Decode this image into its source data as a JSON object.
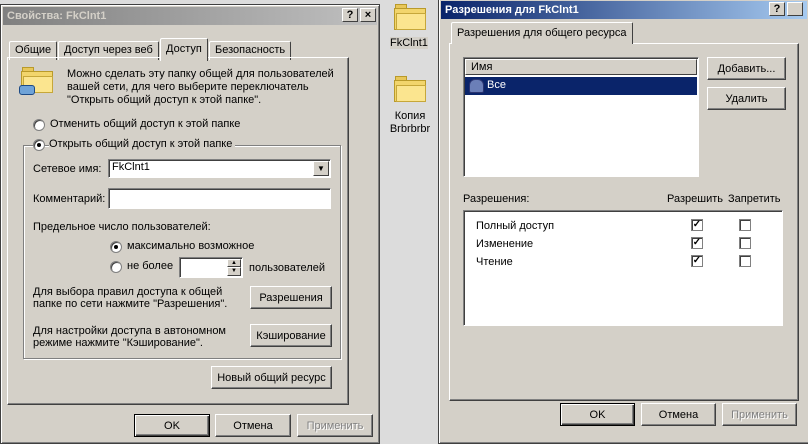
{
  "properties_dialog": {
    "title": "Свойства: FkClnt1",
    "help_glyph": "?",
    "close_glyph": "×",
    "tabs": [
      "Общие",
      "Доступ через веб",
      "Доступ",
      "Безопасность"
    ],
    "description": "Можно сделать эту папку общей для пользователей вашей сети, для чего выберите переключатель \"Открыть общий доступ к этой папке\".",
    "radio_unshare": "Отменить общий доступ к этой папке",
    "radio_share": "Открыть общий доступ к этой папке",
    "share_name_label": "Сетевое имя:",
    "share_name_value": "FkClnt1",
    "comment_label": "Комментарий:",
    "comment_value": "",
    "user_limit_label": "Предельное число пользователей:",
    "radio_max": "максимально возможное",
    "radio_not_more": "не более",
    "users_suffix": "пользователей",
    "permissions_text": "Для выбора правил доступа к общей папке по сети нажмите \"Разрешения\".",
    "permissions_button": "Разрешения",
    "caching_text": "Для настройки доступа в автономном режиме нажмите \"Кэширование\".",
    "caching_button": "Кэширование",
    "new_share_button": "Новый общий ресурс",
    "ok": "OK",
    "cancel": "Отмена",
    "apply": "Применить"
  },
  "desktop": {
    "icons": [
      {
        "label": "FkClnt1"
      },
      {
        "label": "Копия Brbrbrbr"
      }
    ]
  },
  "permissions_dialog": {
    "title": "Разрешения для FkClnt1",
    "help_glyph": "?",
    "tab": "Разрешения для общего ресурса",
    "list_header": "Имя",
    "list_items": [
      "Все"
    ],
    "add_button": "Добавить...",
    "remove_button": "Удалить",
    "permissions_label": "Разрешения:",
    "allow_label": "Разрешить",
    "deny_label": "Запретить",
    "rows": [
      {
        "name": "Полный доступ",
        "allow": "✓",
        "deny": ""
      },
      {
        "name": "Изменение",
        "allow": "✓",
        "deny": ""
      },
      {
        "name": "Чтение",
        "allow": "✓",
        "deny": ""
      }
    ],
    "ok": "OK",
    "cancel": "Отмена",
    "apply": "Применить"
  }
}
